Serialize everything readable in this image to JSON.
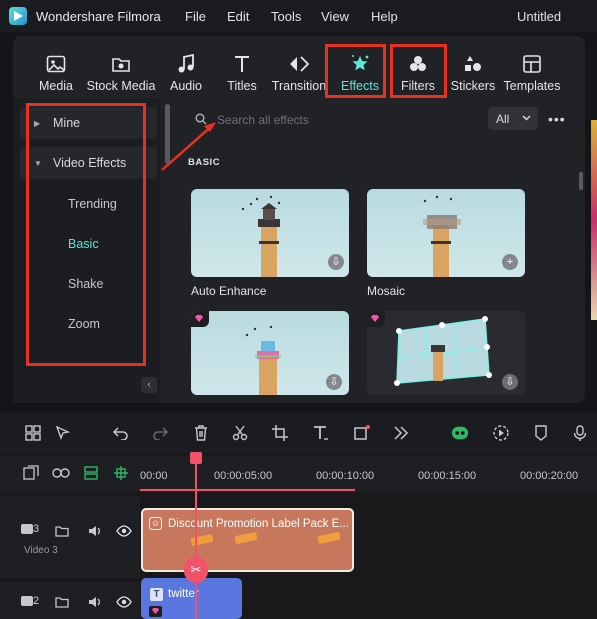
{
  "app": {
    "name": "Wondershare Filmora",
    "document_title": "Untitled",
    "menu": [
      "File",
      "Edit",
      "Tools",
      "View",
      "Help"
    ]
  },
  "toolbar": {
    "tabs": [
      {
        "label": "Media",
        "icon": "media-icon"
      },
      {
        "label": "Stock Media",
        "icon": "stock-media-icon"
      },
      {
        "label": "Audio",
        "icon": "music-note-icon"
      },
      {
        "label": "Titles",
        "icon": "titles-icon"
      },
      {
        "label": "Transition",
        "icon": "transition-icon"
      },
      {
        "label": "Effects",
        "icon": "effects-star-icon",
        "active": true
      },
      {
        "label": "Filters",
        "icon": "filters-icon"
      },
      {
        "label": "Stickers",
        "icon": "stickers-icon"
      },
      {
        "label": "Templates",
        "icon": "templates-icon"
      }
    ]
  },
  "sidebar": {
    "groups": [
      {
        "label": "Mine",
        "expanded": false
      },
      {
        "label": "Video Effects",
        "expanded": true
      }
    ],
    "subitems": [
      "Trending",
      "Basic",
      "Shake",
      "Zoom"
    ],
    "active_subitem": "Basic"
  },
  "search": {
    "placeholder": "Search all effects",
    "filter_value": "All"
  },
  "section": {
    "title": "BASIC"
  },
  "effects": [
    {
      "name": "Auto Enhance",
      "badge": "download-icon",
      "premium": false
    },
    {
      "name": "Mosaic",
      "badge": "add-icon",
      "premium": false
    },
    {
      "name": "",
      "badge": "download-icon",
      "premium": true
    },
    {
      "name": "",
      "badge": "download-icon",
      "premium": true
    }
  ],
  "timeline": {
    "timecodes": [
      "00:00",
      "00:00:05:00",
      "00:00:10:00",
      "00:00:15:00",
      "00:00:20:00"
    ],
    "tracks": [
      {
        "number": "3",
        "label": "Video 3"
      },
      {
        "number": "2",
        "label": ""
      }
    ],
    "clips": [
      {
        "title": "Discount Promotion Label Pack E..."
      },
      {
        "title": "twitter"
      }
    ]
  },
  "colors": {
    "accent": "#5be6d6",
    "highlight": "#e8321f",
    "playhead": "#f2516a",
    "clip_main": "#c7785c",
    "clip_twitter": "#5a77e0"
  }
}
